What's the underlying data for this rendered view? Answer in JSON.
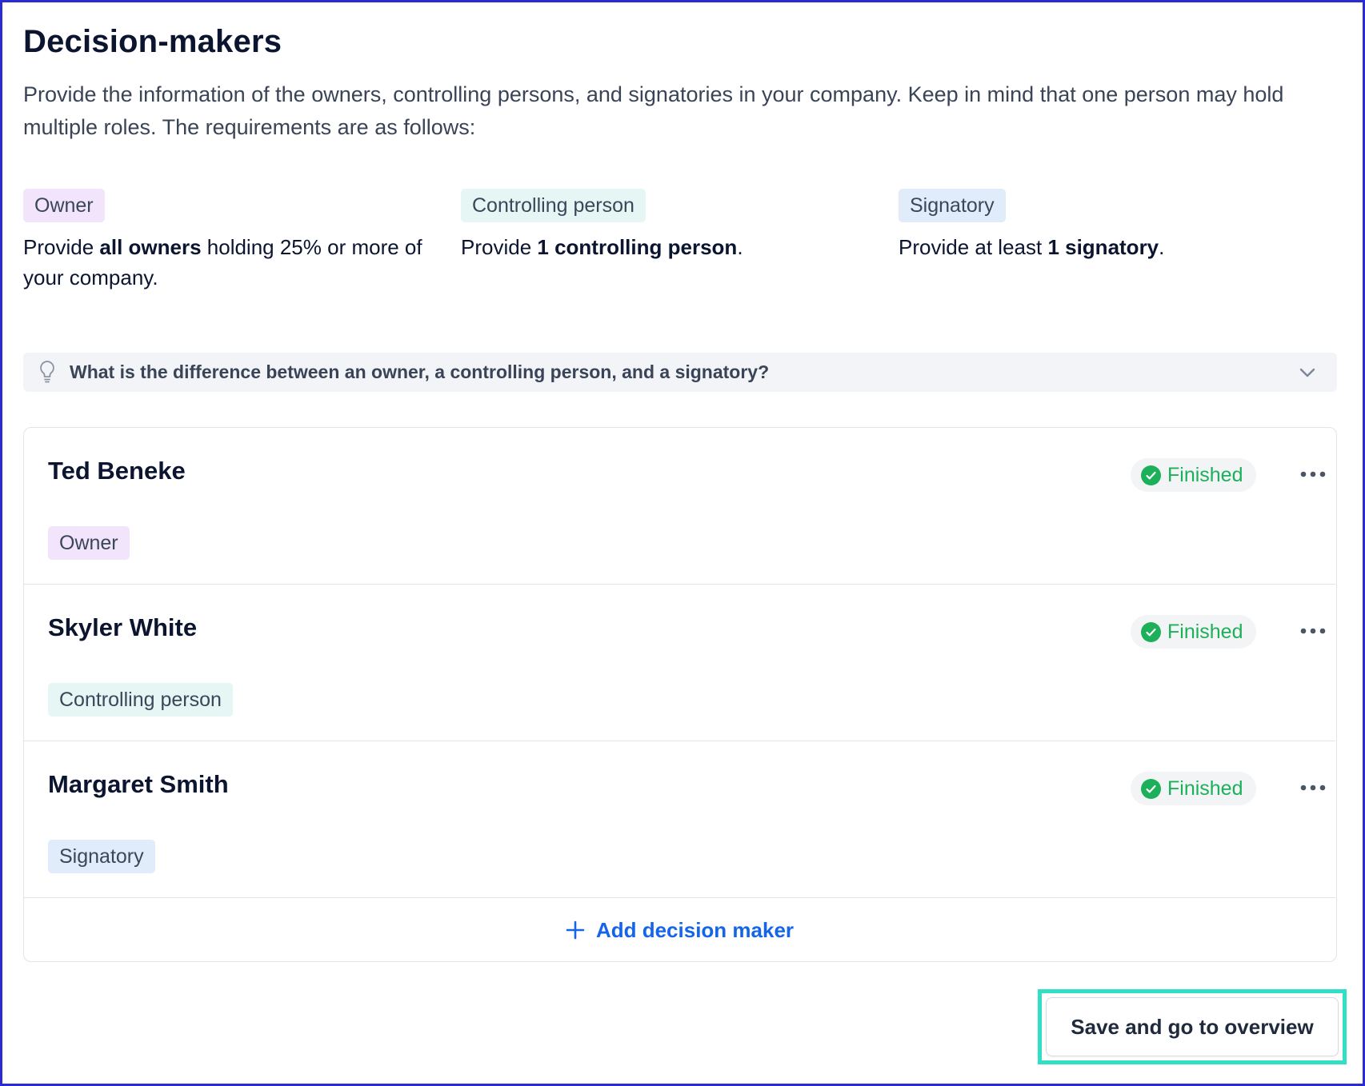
{
  "page": {
    "title": "Decision-makers",
    "intro": "Provide the information of the owners, controlling persons, and signatories in your company. Keep in mind that one person may hold multiple roles. The requirements are as follows:"
  },
  "requirements": [
    {
      "role": "Owner",
      "text_before": "Provide ",
      "text_bold": "all owners",
      "text_after": " holding 25% or more of your company."
    },
    {
      "role": "Controlling person",
      "text_before": "Provide ",
      "text_bold": "1 controlling person",
      "text_after": "."
    },
    {
      "role": "Signatory",
      "text_before": "Provide at least ",
      "text_bold": "1 signatory",
      "text_after": "."
    }
  ],
  "faq": {
    "question": "What is the difference between an owner, a controlling person, and a signatory?",
    "icon": "lightbulb-icon",
    "toggle_icon": "chevron-down-icon"
  },
  "decision_makers": [
    {
      "name": "Ted Beneke",
      "role": "Owner",
      "status": "Finished"
    },
    {
      "name": "Skyler White",
      "role": "Controlling person",
      "status": "Finished"
    },
    {
      "name": "Margaret Smith",
      "role": "Signatory",
      "status": "Finished"
    }
  ],
  "add_button": {
    "label": "Add decision maker",
    "icon": "plus-icon"
  },
  "footer": {
    "save_label": "Save and go to overview"
  },
  "colors": {
    "owner_badge": "#f1e4fb",
    "controlling_badge": "#e6f6f5",
    "signatory_badge": "#e1ecfb",
    "status_green": "#1cb05a",
    "link_blue": "#1565e8",
    "highlight": "#2fe0c4",
    "frame": "#2b2bd6"
  }
}
